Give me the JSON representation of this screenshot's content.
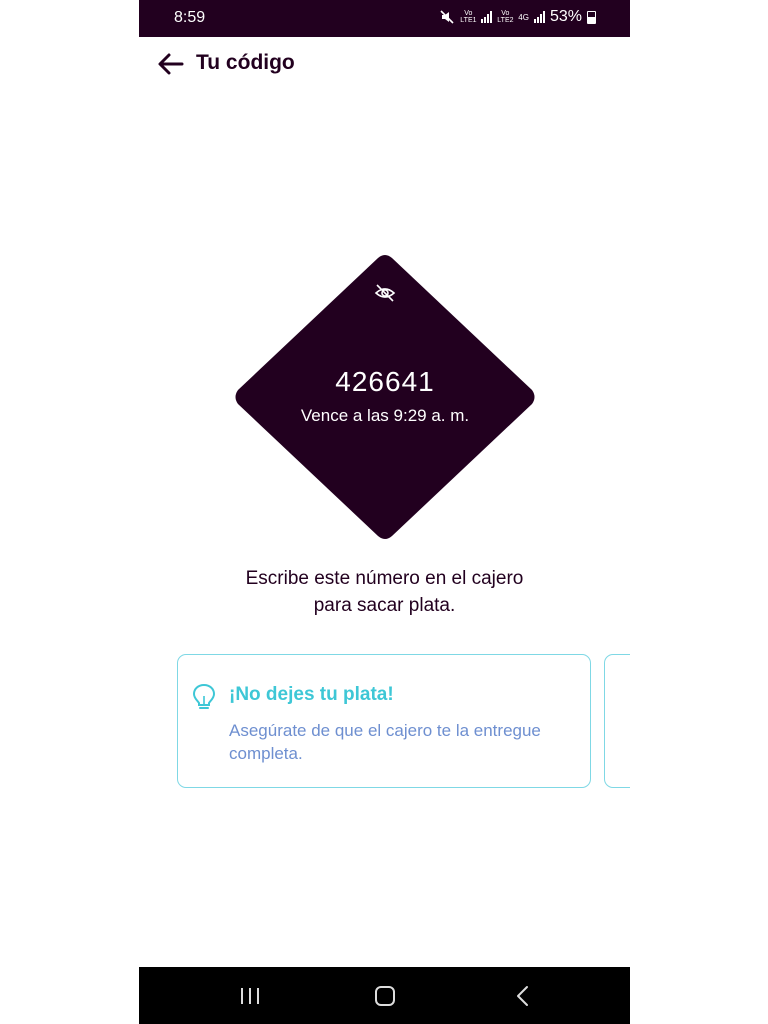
{
  "status_bar": {
    "time": "8:59",
    "sim1": "Vo LTE1",
    "sim2": "Vo LTE2",
    "network": "4G",
    "battery": "53%"
  },
  "header": {
    "title": "Tu código",
    "back_icon": "arrow-left-icon"
  },
  "code_card": {
    "code": "426641",
    "expiry": "Vence a las 9:29 a. m.",
    "visibility_icon": "eye-off-icon",
    "color": "#22001f"
  },
  "instruction": {
    "line1": "Escribe este número en el cajero",
    "line2": "para sacar plata."
  },
  "tip": {
    "icon": "lightbulb-icon",
    "title": "¡No dejes tu plata!",
    "body": "Asegúrate de que el cajero te la entregue completa.",
    "title_color": "#3ec7d6",
    "body_color": "#6e8fd0",
    "border_color": "#7fd8e5"
  },
  "nav_bar": {
    "recents_icon": "recents-icon",
    "home_icon": "home-icon",
    "back_icon": "back-chevron-icon"
  }
}
